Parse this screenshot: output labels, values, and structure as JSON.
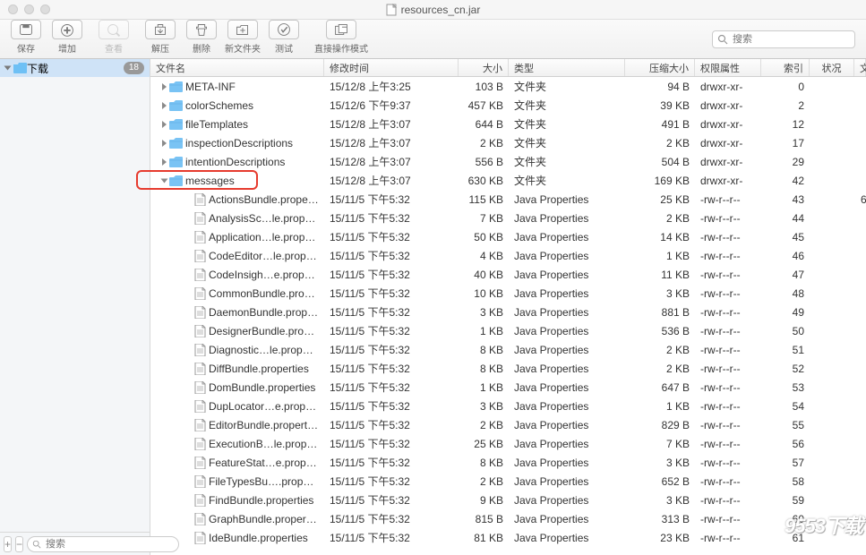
{
  "window": {
    "title": "resources_cn.jar"
  },
  "toolbar": {
    "items": [
      {
        "label": "保存",
        "enabled": true
      },
      {
        "label": "增加",
        "enabled": true
      },
      {
        "label": "查看",
        "enabled": false
      },
      {
        "label": "解压",
        "enabled": true
      },
      {
        "label": "删除",
        "enabled": true
      },
      {
        "label": "新文件夹",
        "enabled": true
      },
      {
        "label": "测试",
        "enabled": true
      },
      {
        "label": "直接操作模式",
        "enabled": true
      }
    ],
    "search_placeholder": "搜索"
  },
  "sidebar": {
    "root": {
      "label": "下载",
      "badge": "18"
    },
    "search_placeholder": "搜索"
  },
  "columns": {
    "name": "文件名",
    "date": "修改时间",
    "size": "大小",
    "type": "类型",
    "csize": "压缩大小",
    "perm": "权限属性",
    "index": "索引",
    "status": "状况",
    "extra": "文"
  },
  "rows": [
    {
      "depth": 0,
      "kind": "folder",
      "expand": "closed",
      "name": "META-INF",
      "date": "15/12/8 上午3:25",
      "size": "103 B",
      "type": "文件夹",
      "csize": "94 B",
      "perm": "drwxr-xr-",
      "index": "0",
      "extra": ""
    },
    {
      "depth": 0,
      "kind": "folder",
      "expand": "closed",
      "name": "colorSchemes",
      "date": "15/12/6 下午9:37",
      "size": "457 KB",
      "type": "文件夹",
      "csize": "39 KB",
      "perm": "drwxr-xr-",
      "index": "2",
      "extra": ""
    },
    {
      "depth": 0,
      "kind": "folder",
      "expand": "closed",
      "name": "fileTemplates",
      "date": "15/12/8 上午3:07",
      "size": "644 B",
      "type": "文件夹",
      "csize": "491 B",
      "perm": "drwxr-xr-",
      "index": "12",
      "extra": ""
    },
    {
      "depth": 0,
      "kind": "folder",
      "expand": "closed",
      "name": "inspectionDescriptions",
      "date": "15/12/8 上午3:07",
      "size": "2 KB",
      "type": "文件夹",
      "csize": "2 KB",
      "perm": "drwxr-xr-",
      "index": "17",
      "extra": ""
    },
    {
      "depth": 0,
      "kind": "folder",
      "expand": "closed",
      "name": "intentionDescriptions",
      "date": "15/12/8 上午3:07",
      "size": "556 B",
      "type": "文件夹",
      "csize": "504 B",
      "perm": "drwxr-xr-",
      "index": "29",
      "extra": ""
    },
    {
      "depth": 0,
      "kind": "folder",
      "expand": "open",
      "highlight": true,
      "name": "messages",
      "date": "15/12/8 上午3:07",
      "size": "630 KB",
      "type": "文件夹",
      "csize": "169 KB",
      "perm": "drwxr-xr-",
      "index": "42",
      "extra": ""
    },
    {
      "depth": 1,
      "kind": "file",
      "name": "ActionsBundle.properties",
      "date": "15/11/5 下午5:32",
      "size": "115 KB",
      "type": "Java Properties",
      "csize": "25 KB",
      "perm": "-rw-r--r--",
      "index": "43",
      "extra": "6"
    },
    {
      "depth": 1,
      "kind": "file",
      "name": "AnalysisSc…le.properties",
      "date": "15/11/5 下午5:32",
      "size": "7 KB",
      "type": "Java Properties",
      "csize": "2 KB",
      "perm": "-rw-r--r--",
      "index": "44",
      "extra": ""
    },
    {
      "depth": 1,
      "kind": "file",
      "name": "Application…le.properties",
      "date": "15/11/5 下午5:32",
      "size": "50 KB",
      "type": "Java Properties",
      "csize": "14 KB",
      "perm": "-rw-r--r--",
      "index": "45",
      "extra": ""
    },
    {
      "depth": 1,
      "kind": "file",
      "name": "CodeEditor…le.properties",
      "date": "15/11/5 下午5:32",
      "size": "4 KB",
      "type": "Java Properties",
      "csize": "1 KB",
      "perm": "-rw-r--r--",
      "index": "46",
      "extra": ""
    },
    {
      "depth": 1,
      "kind": "file",
      "name": "CodeInsigh…e.properties",
      "date": "15/11/5 下午5:32",
      "size": "40 KB",
      "type": "Java Properties",
      "csize": "11 KB",
      "perm": "-rw-r--r--",
      "index": "47",
      "extra": ""
    },
    {
      "depth": 1,
      "kind": "file",
      "name": "CommonBundle.properties",
      "date": "15/11/5 下午5:32",
      "size": "10 KB",
      "type": "Java Properties",
      "csize": "3 KB",
      "perm": "-rw-r--r--",
      "index": "48",
      "extra": ""
    },
    {
      "depth": 1,
      "kind": "file",
      "name": "DaemonBundle.properties",
      "date": "15/11/5 下午5:32",
      "size": "3 KB",
      "type": "Java Properties",
      "csize": "881 B",
      "perm": "-rw-r--r--",
      "index": "49",
      "extra": ""
    },
    {
      "depth": 1,
      "kind": "file",
      "name": "DesignerBundle.properties",
      "date": "15/11/5 下午5:32",
      "size": "1 KB",
      "type": "Java Properties",
      "csize": "536 B",
      "perm": "-rw-r--r--",
      "index": "50",
      "extra": ""
    },
    {
      "depth": 1,
      "kind": "file",
      "name": "Diagnostic…le.properties",
      "date": "15/11/5 下午5:32",
      "size": "8 KB",
      "type": "Java Properties",
      "csize": "2 KB",
      "perm": "-rw-r--r--",
      "index": "51",
      "extra": ""
    },
    {
      "depth": 1,
      "kind": "file",
      "name": "DiffBundle.properties",
      "date": "15/11/5 下午5:32",
      "size": "8 KB",
      "type": "Java Properties",
      "csize": "2 KB",
      "perm": "-rw-r--r--",
      "index": "52",
      "extra": ""
    },
    {
      "depth": 1,
      "kind": "file",
      "name": "DomBundle.properties",
      "date": "15/11/5 下午5:32",
      "size": "1 KB",
      "type": "Java Properties",
      "csize": "647 B",
      "perm": "-rw-r--r--",
      "index": "53",
      "extra": ""
    },
    {
      "depth": 1,
      "kind": "file",
      "name": "DupLocator…e.properties",
      "date": "15/11/5 下午5:32",
      "size": "3 KB",
      "type": "Java Properties",
      "csize": "1 KB",
      "perm": "-rw-r--r--",
      "index": "54",
      "extra": ""
    },
    {
      "depth": 1,
      "kind": "file",
      "name": "EditorBundle.properties",
      "date": "15/11/5 下午5:32",
      "size": "2 KB",
      "type": "Java Properties",
      "csize": "829 B",
      "perm": "-rw-r--r--",
      "index": "55",
      "extra": ""
    },
    {
      "depth": 1,
      "kind": "file",
      "name": "ExecutionB…le.properties",
      "date": "15/11/5 下午5:32",
      "size": "25 KB",
      "type": "Java Properties",
      "csize": "7 KB",
      "perm": "-rw-r--r--",
      "index": "56",
      "extra": ""
    },
    {
      "depth": 1,
      "kind": "file",
      "name": "FeatureStat…e.properties",
      "date": "15/11/5 下午5:32",
      "size": "8 KB",
      "type": "Java Properties",
      "csize": "3 KB",
      "perm": "-rw-r--r--",
      "index": "57",
      "extra": ""
    },
    {
      "depth": 1,
      "kind": "file",
      "name": "FileTypesBu….properties",
      "date": "15/11/5 下午5:32",
      "size": "2 KB",
      "type": "Java Properties",
      "csize": "652 B",
      "perm": "-rw-r--r--",
      "index": "58",
      "extra": ""
    },
    {
      "depth": 1,
      "kind": "file",
      "name": "FindBundle.properties",
      "date": "15/11/5 下午5:32",
      "size": "9 KB",
      "type": "Java Properties",
      "csize": "3 KB",
      "perm": "-rw-r--r--",
      "index": "59",
      "extra": ""
    },
    {
      "depth": 1,
      "kind": "file",
      "name": "GraphBundle.properties",
      "date": "15/11/5 下午5:32",
      "size": "815 B",
      "type": "Java Properties",
      "csize": "313 B",
      "perm": "-rw-r--r--",
      "index": "60",
      "extra": ""
    },
    {
      "depth": 1,
      "kind": "file",
      "name": "IdeBundle.properties",
      "date": "15/11/5 下午5:32",
      "size": "81 KB",
      "type": "Java Properties",
      "csize": "23 KB",
      "perm": "-rw-r--r--",
      "index": "61",
      "extra": ""
    }
  ],
  "watermark": {
    "text": "9553",
    "suffix": "下载"
  }
}
